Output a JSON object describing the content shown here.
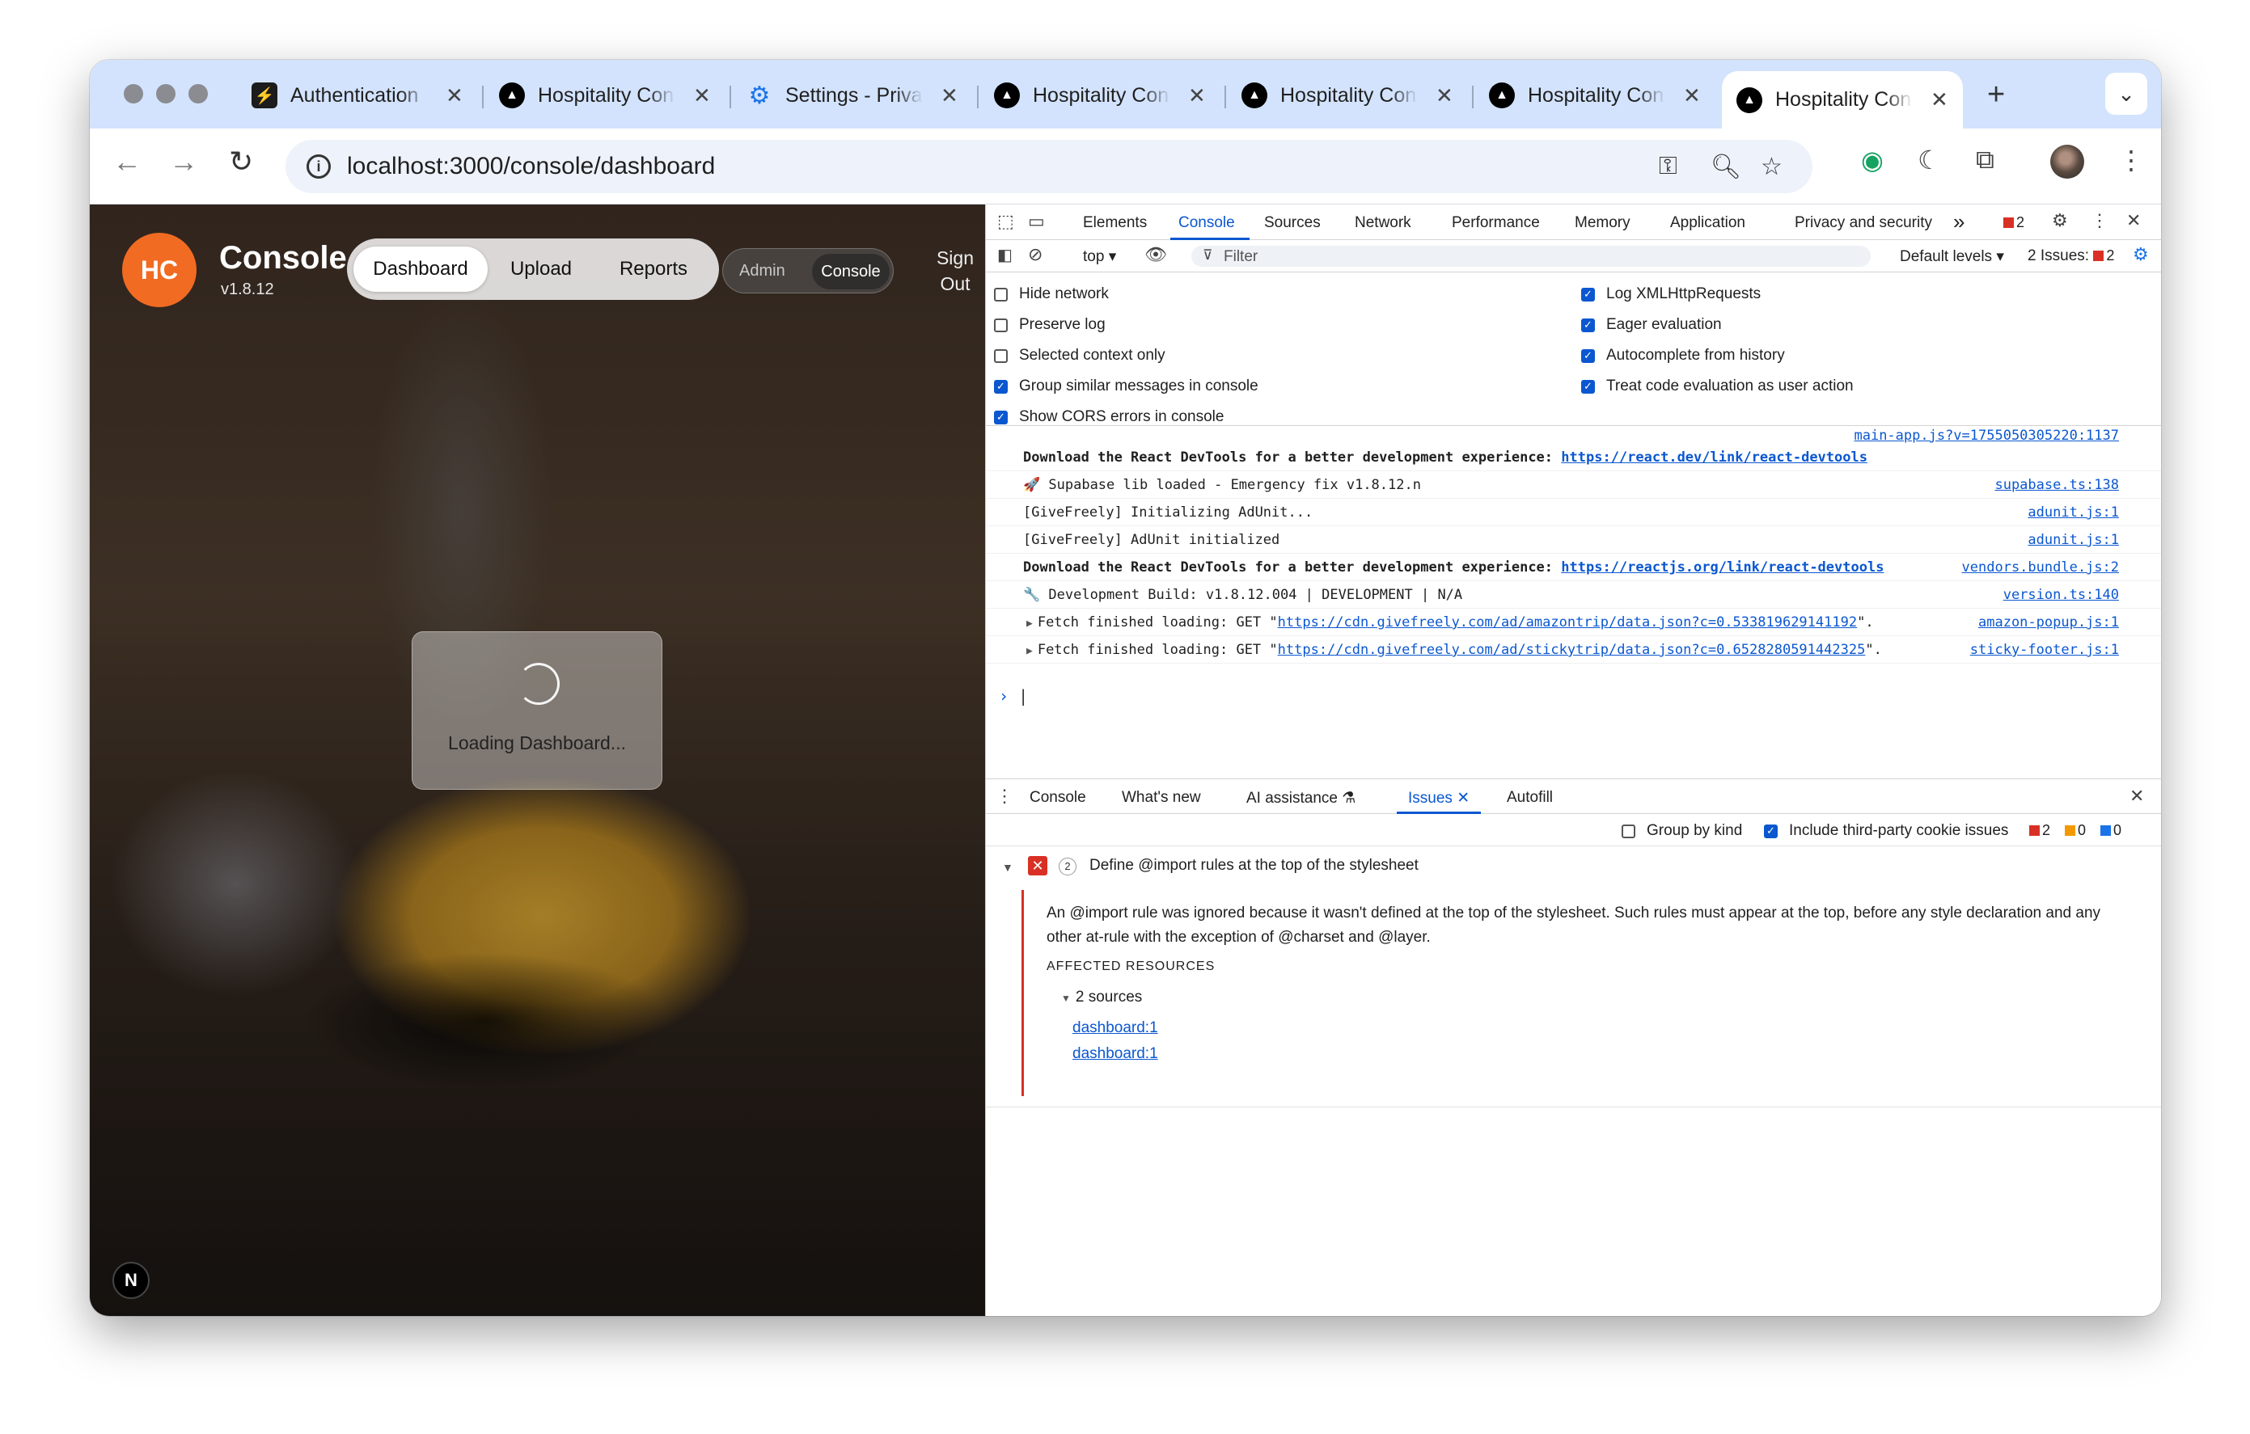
{
  "browser": {
    "tabs": [
      {
        "label": "Authentication",
        "favicon": "supabase-icon"
      },
      {
        "label": "Hospitality Console",
        "favicon": "nextjs-icon"
      },
      {
        "label": "Settings - Privacy",
        "favicon": "gear-icon"
      },
      {
        "label": "Hospitality Console",
        "favicon": "nextjs-icon"
      },
      {
        "label": "Hospitality Console",
        "favicon": "nextjs-icon"
      },
      {
        "label": "Hospitality Console",
        "favicon": "nextjs-icon"
      },
      {
        "label": "Hospitality Console",
        "favicon": "nextjs-icon"
      }
    ],
    "active_tab_index": 6,
    "url": "localhost:3000/console/dashboard"
  },
  "app": {
    "logo_text": "HC",
    "title": "Console",
    "version": "v1.8.12",
    "nav": {
      "dashboard": "Dashboard",
      "upload": "Upload",
      "reports": "Reports"
    },
    "mode": {
      "admin": "Admin",
      "console": "Console"
    },
    "sign_out": "Sign Out",
    "loading_text": "Loading Dashboard...",
    "n_badge": "N"
  },
  "devtools": {
    "tabs": {
      "elements": "Elements",
      "console": "Console",
      "sources": "Sources",
      "network": "Network",
      "performance": "Performance",
      "memory": "Memory",
      "application": "Application",
      "privacy": "Privacy and security",
      "more": "»"
    },
    "error_count": "2",
    "context": "top ▾",
    "filter_placeholder": "Filter",
    "levels": "Default levels ▾",
    "issues_label": "2 Issues:",
    "issues_count": "2",
    "settings_left": [
      {
        "label": "Hide network",
        "checked": false
      },
      {
        "label": "Preserve log",
        "checked": false
      },
      {
        "label": "Selected context only",
        "checked": false
      },
      {
        "label": "Group similar messages in console",
        "checked": true
      },
      {
        "label": "Show CORS errors in console",
        "checked": true
      }
    ],
    "settings_right": [
      {
        "label": "Log XMLHttpRequests",
        "checked": true
      },
      {
        "label": "Eager evaluation",
        "checked": true
      },
      {
        "label": "Autocomplete from history",
        "checked": true
      },
      {
        "label": "Treat code evaluation as user action",
        "checked": true
      }
    ],
    "logs": {
      "l0_src": "main-app.js?v=1755050305220:1137",
      "l1_msg": "Download the React DevTools for a better development experience: ",
      "l1_link": "https://react.dev/link/react-devtools",
      "l2_msg": "🚀 Supabase lib loaded - Emergency fix v1.8.12.n",
      "l2_src": "supabase.ts:138",
      "l3_msg": "[GiveFreely] Initializing AdUnit...",
      "l3_src": "adunit.js:1",
      "l4_msg": "[GiveFreely] AdUnit initialized",
      "l4_src": "adunit.js:1",
      "l5_msg": "Download the React DevTools for a better development experience: ",
      "l5_link": "https://reactjs.org/link/react-devtools",
      "l5_src": "vendors.bundle.js:2",
      "l6_msg": "🔧 Development Build: v1.8.12.004 | DEVELOPMENT | N/A",
      "l6_src": "version.ts:140",
      "l7_pre": "Fetch finished loading: GET \"",
      "l7_link": "https://cdn.givefreely.com/ad/amazontrip/data.json?c=0.533819629141192",
      "l7_post": "\".",
      "l7_src": "amazon-popup.js:1",
      "l8_pre": "Fetch finished loading: GET \"",
      "l8_link": "https://cdn.givefreely.com/ad/stickytrip/data.json?c=0.6528280591442325",
      "l8_post": "\".",
      "l8_src": "sticky-footer.js:1"
    },
    "drawer": {
      "console": "Console",
      "whats_new": "What's new",
      "ai": "AI assistance ⚗",
      "issues": "Issues",
      "autofill": "Autofill"
    },
    "issues_panel": {
      "group_by_kind": "Group by kind",
      "include_third_party": "Include third-party cookie issues",
      "err": "2",
      "warn": "0",
      "info": "0",
      "issue_count": "2",
      "title": "Define @import rules at the top of the stylesheet",
      "description": "An @import rule was ignored because it wasn't defined at the top of the stylesheet. Such rules must appear at the top, before any style declaration and any other at-rule with the exception of @charset and @layer.",
      "affected": "AFFECTED RESOURCES",
      "sources": "2 sources",
      "resources": [
        "dashboard:1",
        "dashboard:1"
      ]
    }
  }
}
